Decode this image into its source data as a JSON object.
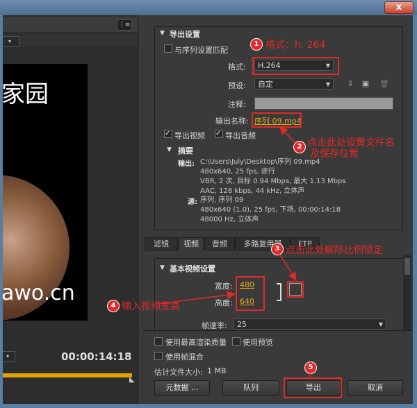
{
  "window": {
    "close_glyph": "x"
  },
  "preview": {
    "panel_menu": "⋮≡",
    "video_text_top": "家园",
    "video_text_bottom": "awo.cn",
    "timecode": "00:00:14:18"
  },
  "export_settings": {
    "section_title": "导出设置",
    "match_sequence_label": "与序列设置匹配",
    "format_label": "格式:",
    "format_value": "H.264",
    "preset_label": "预设:",
    "preset_value": "自定",
    "comment_label": "注释:",
    "comment_value": "",
    "output_name_label": "输出名称:",
    "output_name_value": "序列 09.mp4",
    "export_video_label": "导出视频",
    "export_audio_label": "导出音频",
    "export_video_checked": true,
    "export_audio_checked": true,
    "match_sequence_checked": false
  },
  "summary": {
    "title": "摘要",
    "output_label": "输出:",
    "output_lines": [
      "C:\\Users\\July\\Desktop\\序列 09.mp4",
      "480x640, 25 fps, 逐行",
      "VBR, 2 次, 目标 0.94 Mbps, 最大 1.13 Mbps",
      "AAC, 128 kbps, 44 kHz, 立体声"
    ],
    "source_label": "源:",
    "source_lines": [
      "序列, 序列 09",
      "480x640 (1.0), 25 fps, 下场, 00:00:14:18",
      "48000 Hz, 立体声"
    ]
  },
  "tabs": [
    "滤镜",
    "视频",
    "音频",
    "多路复用器",
    "FTP"
  ],
  "active_tab": "视频",
  "basic_video": {
    "title": "基本视频设置",
    "width_label": "宽度:",
    "width_value": "480",
    "height_label": "高度:",
    "height_value": "640",
    "framerate_label": "帧速率:",
    "framerate_value": "25"
  },
  "bottom": {
    "max_render_label": "使用最高渲染质量",
    "use_preview_label": "使用预览",
    "frame_blend_label": "使用帧混合",
    "file_size_label": "估计文件大小:",
    "file_size_value": "1 MB",
    "metadata_button": "元数据 ...",
    "queue_button": "队列",
    "export_button": "导出",
    "cancel_button": "取消"
  },
  "annotations": {
    "a1": {
      "num": "1",
      "text": "格式：h. 264"
    },
    "a2": {
      "num": "2",
      "text_line1": "点击此处设置文件名",
      "text_line2": "及保存位置"
    },
    "a3": {
      "num": "3",
      "text": "点击此处解除比例锁定"
    },
    "a4": {
      "num": "4",
      "text": "输入视频宽高"
    },
    "a5": {
      "num": "5"
    }
  },
  "colors": {
    "accent_link": "#e6a817",
    "annotation_red": "#e02a2a",
    "timeline": "#e1a400"
  }
}
